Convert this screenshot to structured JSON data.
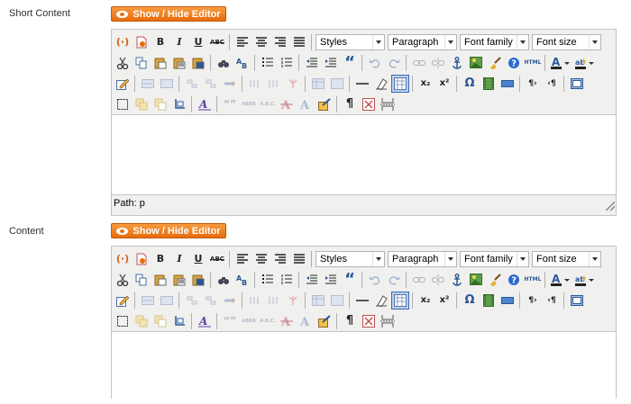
{
  "sections": [
    {
      "label": "Short Content",
      "toggle_label": "Show / Hide Editor",
      "status_path": "Path: p"
    },
    {
      "label": "Content",
      "toggle_label": "Show / Hide Editor",
      "status_path": ""
    }
  ],
  "toolbar": {
    "dropdowns": {
      "styles": "Styles",
      "paragraph": "Paragraph",
      "font_family": "Font family",
      "font_size": "Font size"
    },
    "glyphs": {
      "bold": "B",
      "italic": "I",
      "underline": "U",
      "strike": "ABC",
      "blockquote": "“",
      "subscript": "x₂",
      "superscript": "x²",
      "omega": "Ω",
      "pilcrow": "¶",
      "html": "HTML",
      "text_a": "A",
      "abbr": "ABBR",
      "acronym": "A.B.C.",
      "cite": "“”",
      "ltr": "¶›",
      "rtl": "‹¶"
    }
  },
  "colors": {
    "accent_orange": "#f2851f",
    "toolbar_bg": "#f0f0ee",
    "selected_border": "#316ac5"
  }
}
